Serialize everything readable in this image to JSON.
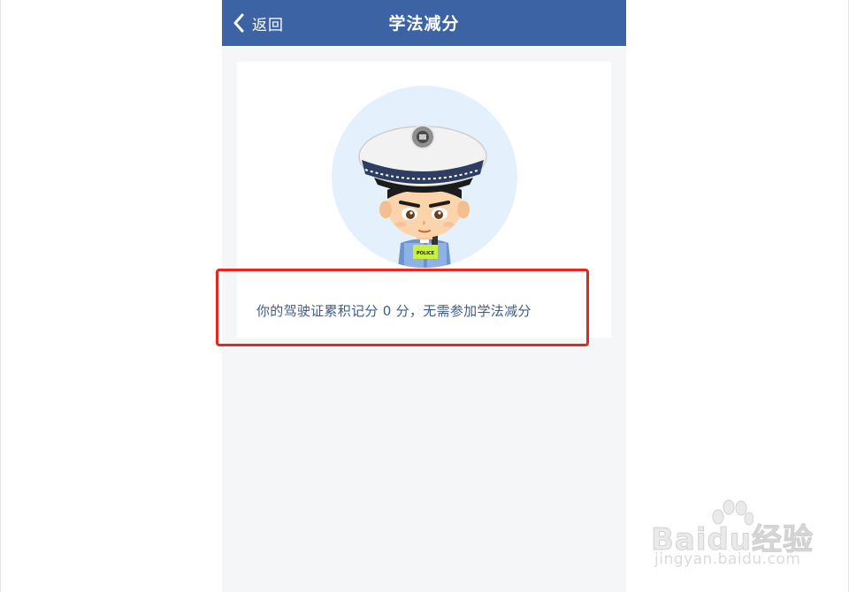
{
  "navbar": {
    "back_label": "返回",
    "title": "学法减分"
  },
  "card": {
    "avatar_badge_text": "POLICE",
    "message": "你的驾驶证累积记分 0 分，无需参加学法减分"
  },
  "watermark": {
    "logo": "Baidu经验",
    "url": "jingyan.baidu.com"
  },
  "colors": {
    "navbar": "#3c64a4",
    "message_text": "#3c5d91",
    "highlight": "#e8251f",
    "page_bg": "#f5f6f8"
  }
}
